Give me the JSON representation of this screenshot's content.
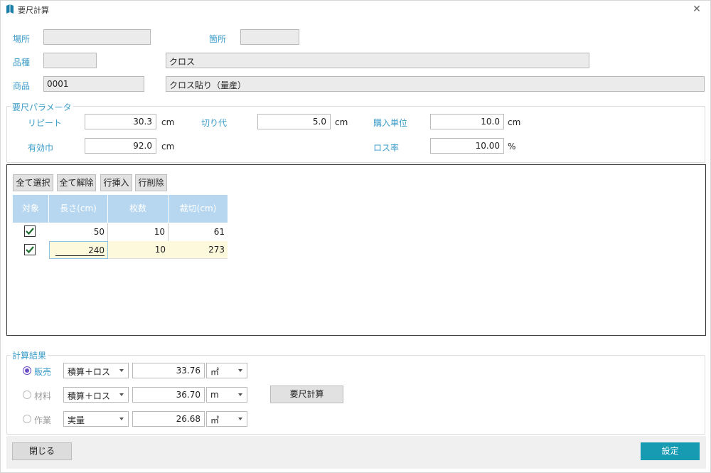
{
  "window": {
    "title": "要尺計算"
  },
  "header": {
    "basho_label": "場所",
    "basho_value": "",
    "kasho_label": "箇所",
    "kasho_value": "",
    "hinshu_label": "品種",
    "hinshu_code": "",
    "hinshu_name": "クロス",
    "shohin_label": "商品",
    "shohin_code": "0001",
    "shohin_name": "クロス貼り（量産）"
  },
  "params": {
    "title": "要尺パラメータ",
    "repeat_label": "リピート",
    "repeat_value": "30.3",
    "repeat_unit": "cm",
    "cut_label": "切り代",
    "cut_value": "5.0",
    "cut_unit": "cm",
    "unit_label": "購入単位",
    "unit_value": "10.0",
    "unit_unit": "cm",
    "width_label": "有効巾",
    "width_value": "92.0",
    "width_unit": "cm",
    "loss_label": "ロス率",
    "loss_value": "10.00",
    "loss_unit": "%"
  },
  "grid": {
    "buttons": [
      "全て選択",
      "全て解除",
      "行挿入",
      "行削除"
    ],
    "columns": [
      "対象",
      "長さ(cm)",
      "枚数",
      "裁切(cm)"
    ],
    "rows": [
      {
        "checked": true,
        "length": "50",
        "count": "10",
        "cut": "61"
      },
      {
        "checked": true,
        "length": "240",
        "count": "10",
        "cut": "273"
      }
    ]
  },
  "results": {
    "title": "計算結果",
    "rows": [
      {
        "label": "販売",
        "selected": true,
        "method": "積算＋ロス",
        "value": "33.76",
        "unit": "㎡"
      },
      {
        "label": "材料",
        "selected": false,
        "method": "積算＋ロス",
        "value": "36.70",
        "unit": "m"
      },
      {
        "label": "作業",
        "selected": false,
        "method": "実量",
        "value": "26.68",
        "unit": "㎡"
      }
    ],
    "calc_button": "要尺計算"
  },
  "footer": {
    "close_label": "閉じる",
    "set_label": "設定"
  },
  "colors": {
    "label": "#3c9cc9",
    "header": "#b7d6ef",
    "primary": "#169bb3",
    "radio": "#6a4bc4",
    "highlight_row": "#fdf9dc"
  }
}
